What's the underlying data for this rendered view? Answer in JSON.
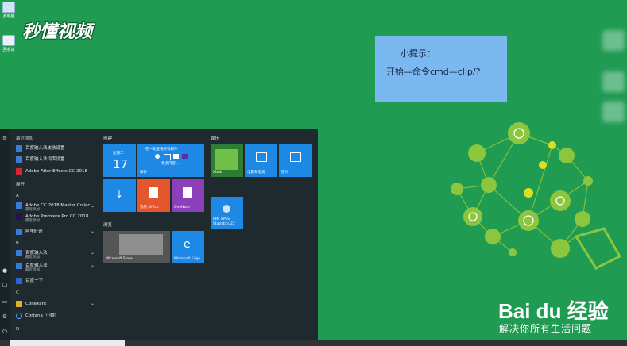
{
  "desktop": {
    "icons": [
      {
        "label": "此电脑"
      },
      {
        "label": "回收站"
      }
    ],
    "watermark": "秒懂视频"
  },
  "tip": {
    "title": "小提示：",
    "text": "开始—命令cmd—clip/?"
  },
  "start_menu": {
    "recent_header": "最近添加",
    "recent_items": [
      "百度输入法皮肤设置",
      "百度输入法词库设置",
      "Adobe After Effects CC 2018"
    ],
    "expand_label": "展开",
    "letter_a": "A",
    "a_items": [
      {
        "name": "Adobe CC 2018 Master Collec...",
        "sub": "最近添加"
      },
      {
        "name": "Adobe Premiere Pro CC 2018",
        "sub": "最近添加"
      },
      {
        "name": "阿里旺旺",
        "sub": ""
      }
    ],
    "letter_b": "B",
    "b_items": [
      {
        "name": "百度输入法",
        "sub": "最近添加"
      },
      {
        "name": "百度输入法",
        "sub": "最近添加"
      },
      {
        "name": "百度一下",
        "sub": ""
      }
    ],
    "letter_c": "C",
    "c_items": [
      {
        "name": "Conexant",
        "sub": ""
      },
      {
        "name": "Cortana (小娜)",
        "sub": ""
      }
    ],
    "letter_d": "D",
    "sections": {
      "create": "创建",
      "play": "娱乐",
      "browse": "浏览"
    },
    "tiles": {
      "calendar_day": "星期二",
      "calendar_date": "17",
      "mail_header": "在一处查看所有邮件",
      "mail_more": "更多内容...",
      "mail_label": "邮件",
      "xbox": "Xbox",
      "movies": "电影和电视",
      "photos": "照片",
      "download": "",
      "office": "我的 Office",
      "onenote": "OneNote",
      "spss": "IBM SPSS Statistics 22",
      "store": "Microsoft Store",
      "edge": "Microsoft Edge"
    }
  },
  "baidu": {
    "logo": "Bai du 经验",
    "tagline": "解决你所有生活问题"
  },
  "colors": {
    "desktop_bg": "#1f9b52",
    "tip_bg": "#7cb8f0",
    "tile_blue": "#1e88e5",
    "office_orange": "#e4572e",
    "onenote_purple": "#8b3fb8"
  }
}
